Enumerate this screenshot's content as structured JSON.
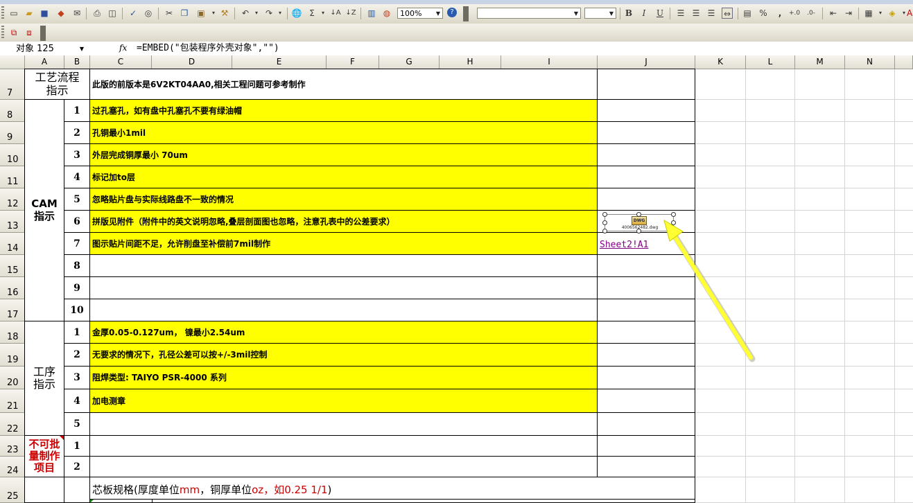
{
  "toolbar": {
    "zoom": "100%",
    "font_name": "",
    "font_size": "",
    "icons": [
      "new-file-icon",
      "open-folder-icon",
      "save-icon",
      "permission-icon",
      "email-icon",
      "print-icon",
      "print-preview-icon",
      "spelling-icon",
      "research-icon",
      "cut-icon",
      "copy-icon",
      "paste-icon",
      "format-painter-icon",
      "undo-icon",
      "redo-icon",
      "hyperlink-icon",
      "autosum-icon",
      "sort-asc-icon",
      "sort-desc-icon",
      "chart-wizard-icon",
      "drawing-icon",
      "help-icon",
      "bold-icon",
      "italic-icon",
      "underline-icon",
      "align-left-icon",
      "align-center-icon",
      "align-right-icon",
      "merge-center-icon",
      "currency-icon",
      "percent-icon",
      "comma-icon",
      "increase-decimal-icon",
      "decrease-decimal-icon",
      "decrease-indent-icon",
      "increase-indent-icon",
      "borders-icon",
      "fill-color-icon",
      "font-color-icon"
    ],
    "bold": "B",
    "italic": "I",
    "underline": "U",
    "sum_symbol": "Σ",
    "percent": "%",
    "comma": ","
  },
  "formula_bar": {
    "name_box": "对象 125",
    "fx": "fx",
    "formula": "=EMBED(\"包装程序外壳对象\",\"\")"
  },
  "columns": [
    "A",
    "B",
    "C",
    "D",
    "E",
    "F",
    "G",
    "H",
    "I",
    "J",
    "K",
    "L",
    "M",
    "N"
  ],
  "rows": [
    "7",
    "8",
    "9",
    "10",
    "11",
    "12",
    "13",
    "14",
    "15",
    "16",
    "17",
    "18",
    "19",
    "20",
    "21",
    "22",
    "23",
    "24",
    "25"
  ],
  "sections": {
    "process": "工艺流程指示",
    "cam": "CAM指示",
    "procedure": "工序指示",
    "nonbatch": "不可批量制作项目"
  },
  "content": {
    "r7": "此版的前版本是6V2KT04AA0,相关工程问题可参考制作",
    "cam_items": [
      {
        "n": "1",
        "text": "过孔塞孔，如有盘中孔塞孔不要有绿油帽",
        "yellow": true
      },
      {
        "n": "2",
        "text": "孔铜最小1mil",
        "yellow": true
      },
      {
        "n": "3",
        "text": "外层完成铜厚最小 70um",
        "yellow": true
      },
      {
        "n": "4",
        "text": "标记加to层",
        "yellow": true
      },
      {
        "n": "5",
        "text": "忽略贴片盘与实际线路盘不一致的情况",
        "yellow": true
      },
      {
        "n": "6",
        "text": "拼版见附件（附件中的英文说明忽略,叠层剖面图也忽略，注意孔表中的公差要求）",
        "yellow": true
      },
      {
        "n": "7",
        "text": "图示贴片间距不足，允许削盘至补偿前7mil制作",
        "yellow": true
      },
      {
        "n": "8",
        "text": "",
        "yellow": false
      },
      {
        "n": "9",
        "text": "",
        "yellow": false
      },
      {
        "n": "10",
        "text": "",
        "yellow": false
      }
    ],
    "proc_items": [
      {
        "n": "1",
        "text": "金厚0.05-0.127um， 镍最小2.54um",
        "yellow": true
      },
      {
        "n": "2",
        "text": "无要求的情况下，孔径公差可以按+/-3mil控制",
        "yellow": true
      },
      {
        "n": "3",
        "text": "阻焊类型: TAIYO PSR-4000 系列",
        "yellow": true
      },
      {
        "n": "4",
        "text": "加电测章",
        "yellow": true
      },
      {
        "n": "5",
        "text": "",
        "yellow": false
      }
    ],
    "nonbatch_items": [
      {
        "n": "1"
      },
      {
        "n": "2"
      }
    ],
    "core_spec": {
      "part1": "芯板规格(厚度单位",
      "part2": "mm",
      "part3": "，铜厚单位",
      "part4": "oz",
      "part5": "，如",
      "part6": "0.25 1/1",
      "part7": ")"
    }
  },
  "embedded_object": {
    "icon_label": "DWG",
    "filename": "4006562482.dwg"
  },
  "link": "Sheet2!A1",
  "colors": {
    "highlight": "#ffff00",
    "red_text": "#cc0000",
    "arrow": "#ffff33",
    "link": "#800080"
  }
}
